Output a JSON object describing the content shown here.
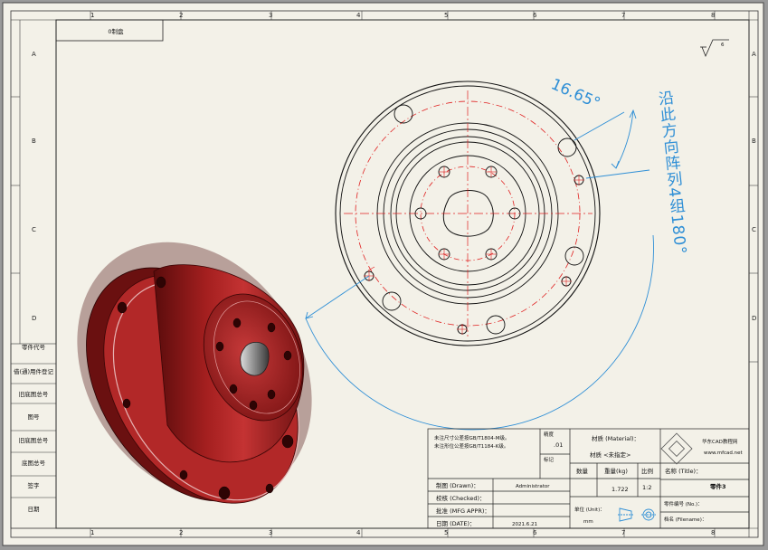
{
  "zones": {
    "top": [
      "1",
      "2",
      "3",
      "4",
      "5",
      "6",
      "7",
      "8"
    ],
    "bottom": [
      "1",
      "2",
      "3",
      "4",
      "5",
      "6",
      "7",
      "8"
    ],
    "left": [
      "A",
      "B",
      "C",
      "D"
    ],
    "right": [
      "A",
      "B",
      "C",
      "D"
    ]
  },
  "header_box": {
    "label": "0制盘"
  },
  "surface_symbol": {
    "label": "6"
  },
  "annotations": {
    "angle": "16.65°",
    "pattern_note": "沿此方向阵列4组180°"
  },
  "left_column": {
    "items": [
      "零件代号",
      "借(通)用件登记",
      "旧底图总号",
      "图号",
      "旧底图总号",
      "底图总号",
      "签字",
      "日期"
    ]
  },
  "title_block": {
    "tolerance_note_1": "未注尺寸公差按GB/T1804-M级。",
    "tolerance_note_2": "未注形位公差按GB/T1184-K级。",
    "precision_label": "精度",
    "precision_value": ".01",
    "mark_label": "标记",
    "material_label": "材质 (Material)：",
    "material_value": "材质 <未指定>",
    "quantity_label": "数量",
    "weight_label": "重量(kg)",
    "weight_value": "1.722",
    "scale_label": "比例",
    "scale_value": "1:2",
    "name_label": "名称 (Title)：",
    "name_value": "零件3",
    "drawn_label": "制图 (Drawn)：",
    "drawn_value": "Administrator",
    "checked_label": "校核 (Checked)：",
    "approved_label": "批准 (MFG APPR)：",
    "date_label": "日期 (DATE)：",
    "date_value": "2021.6.21",
    "unit_label": "单位 (Unit)：",
    "unit_value": "mm",
    "company_name": "华东CAD教程网",
    "company_url": "www.mfcad.net",
    "part_no_label": "零件编号 (No.)：",
    "file_label": "档名 (Filename)："
  }
}
